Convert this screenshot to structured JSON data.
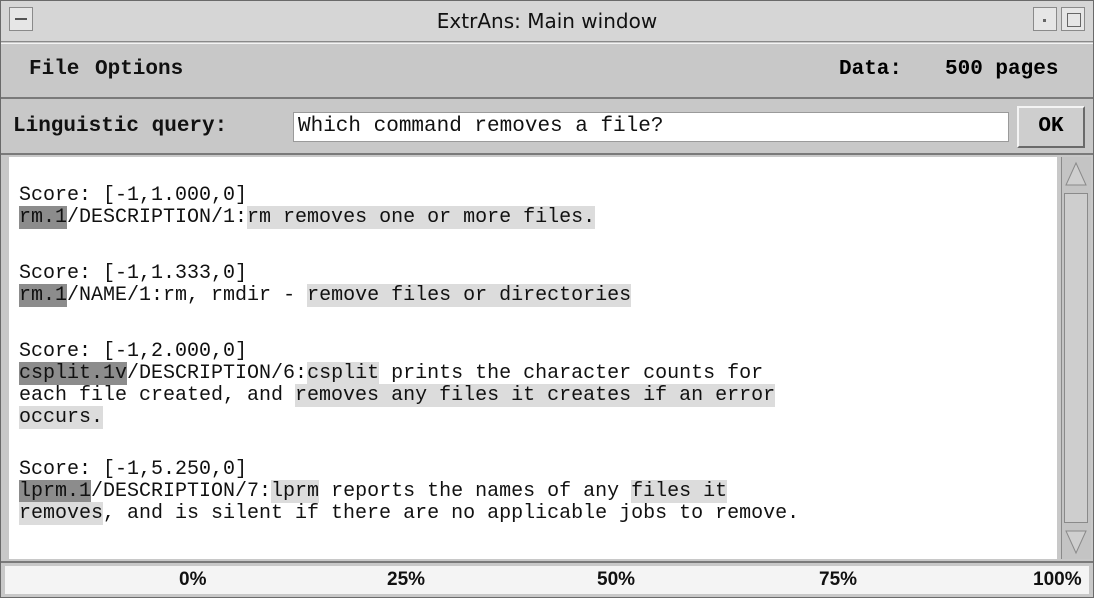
{
  "window": {
    "title": "ExtrAns: Main window"
  },
  "menu": {
    "file": "File",
    "options": "Options",
    "data_label": "Data:",
    "data_value": "500 pages"
  },
  "query": {
    "label": "Linguistic query:",
    "value": "Which command removes a file?",
    "ok": "OK"
  },
  "results": [
    {
      "score": "Score: [-1,1.000,0]",
      "line1": {
        "doc": "rm.1",
        "path": "/DESCRIPTION/1:",
        "hl": "rm removes one or more files.",
        "rest": ""
      },
      "line2": null,
      "line3": null
    },
    {
      "score": "Score: [-1,1.333,0]",
      "line1": {
        "doc": "rm.1",
        "path": "/NAME/1:",
        "hl": "rm, rmdir",
        "rest": " - ",
        "hl2": "remove files or directories"
      },
      "line2": null,
      "line3": null
    },
    {
      "score": "Score: [-1,2.000,0]",
      "line1": {
        "doc": "csplit.1v",
        "path": "/DESCRIPTION/6:",
        "hl": "csplit",
        "rest": " prints the character counts for"
      },
      "line2": {
        "pre": "each file created, and ",
        "hl": "removes any files it creates if an error"
      },
      "line3": {
        "hl": "occurs."
      }
    },
    {
      "score": "Score: [-1,5.250,0]",
      "line1": {
        "doc": "lprm.1",
        "path": "/DESCRIPTION/7:",
        "hl": "lprm",
        "rest": " reports the names of any ",
        "hl2": "files it"
      },
      "line2": {
        "hl": "removes",
        "rest": ", and is silent if there are no applicable jobs to remove."
      },
      "line3": null
    }
  ],
  "progress": {
    "value_percent": 100,
    "ticks": [
      "0%",
      "25%",
      "50%",
      "75%",
      "100%"
    ]
  },
  "colors": {
    "doc_highlight": "#8c8c8c",
    "text_highlight": "#dcdcdc",
    "chrome": "#c8c8c8"
  }
}
